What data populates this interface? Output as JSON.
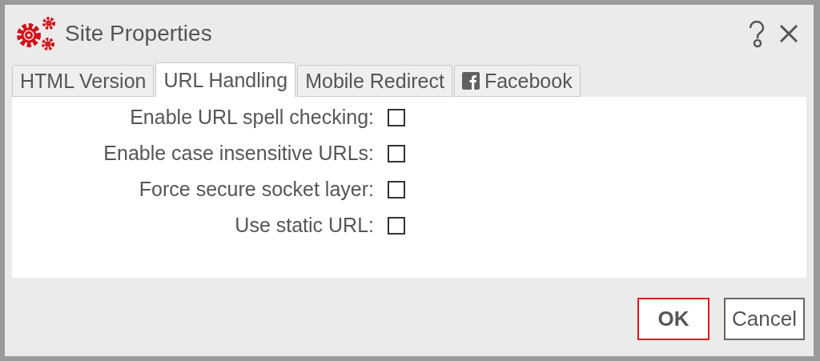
{
  "window": {
    "title": "Site Properties"
  },
  "tabs": [
    {
      "label": "HTML Version",
      "selected": false,
      "kind": "text"
    },
    {
      "label": "URL Handling",
      "selected": true,
      "kind": "text"
    },
    {
      "label": "Mobile Redirect",
      "selected": false,
      "kind": "text"
    },
    {
      "label": "Facebook",
      "selected": false,
      "kind": "facebook"
    }
  ],
  "options": [
    {
      "label": "Enable URL spell checking:",
      "checked": false
    },
    {
      "label": "Enable case insensitive URLs:",
      "checked": false
    },
    {
      "label": "Force secure socket layer:",
      "checked": false
    },
    {
      "label": "Use static URL:",
      "checked": false
    }
  ],
  "buttons": [
    {
      "label": "OK",
      "kind": "primary"
    },
    {
      "label": "Cancel",
      "kind": "secondary"
    }
  ]
}
